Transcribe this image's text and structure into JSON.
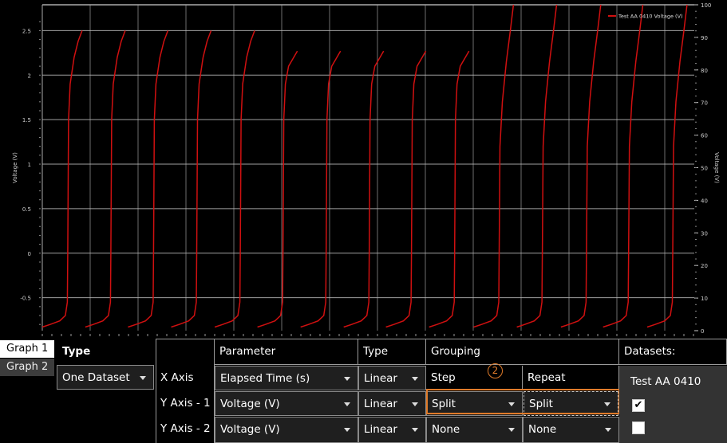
{
  "chart_data": {
    "type": "line",
    "title": "",
    "xlabel": "",
    "ylabel": "Voltage (V)",
    "y2label": "Voltage (V)",
    "xlim": [
      0,
      13.6
    ],
    "ylim": [
      -0.87,
      2.79
    ],
    "y2lim": [
      0,
      100
    ],
    "yticks": [
      "-0.5",
      "0",
      "0.5",
      "1",
      "1.5",
      "2",
      "2.5"
    ],
    "y2ticks": [
      "0",
      "10",
      "20",
      "30",
      "40",
      "50",
      "60",
      "70",
      "80",
      "90",
      "100"
    ],
    "grid": true,
    "legend": {
      "position": "top-right",
      "entries": [
        "Test AA 0410 Voltage (V)"
      ]
    },
    "series_color": "#d01010",
    "cycles": [
      {
        "end_x": 0.83,
        "end_v": 2.5
      },
      {
        "end_x": 1.73,
        "end_v": 2.5
      },
      {
        "end_x": 2.62,
        "end_v": 2.5
      },
      {
        "end_x": 3.52,
        "end_v": 2.5
      },
      {
        "end_x": 4.43,
        "end_v": 2.5
      },
      {
        "end_x": 5.32,
        "end_v": 2.27
      },
      {
        "end_x": 6.22,
        "end_v": 2.27
      },
      {
        "end_x": 7.12,
        "end_v": 2.27
      },
      {
        "end_x": 8.0,
        "end_v": 2.27
      },
      {
        "end_x": 8.9,
        "end_v": 2.27
      },
      {
        "end_x": 9.83,
        "end_v": 2.8
      },
      {
        "end_x": 10.73,
        "end_v": 2.8
      },
      {
        "end_x": 11.65,
        "end_v": 2.8
      },
      {
        "end_x": 12.53,
        "end_v": 2.8
      },
      {
        "end_x": 13.45,
        "end_v": 2.8
      }
    ]
  },
  "tabs": [
    "Graph 1",
    "Graph 2"
  ],
  "type_panel": {
    "label": "Type",
    "value": "One Dataset"
  },
  "table": {
    "headers": {
      "parameter": "Parameter",
      "type": "Type",
      "grouping": "Grouping",
      "datasets": "Datasets:"
    },
    "subheaders": {
      "step": "Step",
      "repeat": "Repeat"
    },
    "rows": [
      {
        "label": "X Axis",
        "parameter": "Elapsed Time (s)",
        "type": "Linear"
      },
      {
        "label": "Y Axis - 1",
        "parameter": "Voltage (V)",
        "type": "Linear",
        "step": "Split",
        "repeat": "Split"
      },
      {
        "label": "Y Axis - 2",
        "parameter": "Voltage (V)",
        "type": "Linear",
        "step": "None",
        "repeat": "None"
      }
    ]
  },
  "datasets": {
    "name": "Test AA 0410",
    "y1_checked": true,
    "y2_checked": false
  },
  "annotation": {
    "marker": "2",
    "color": "#e07b2a"
  }
}
